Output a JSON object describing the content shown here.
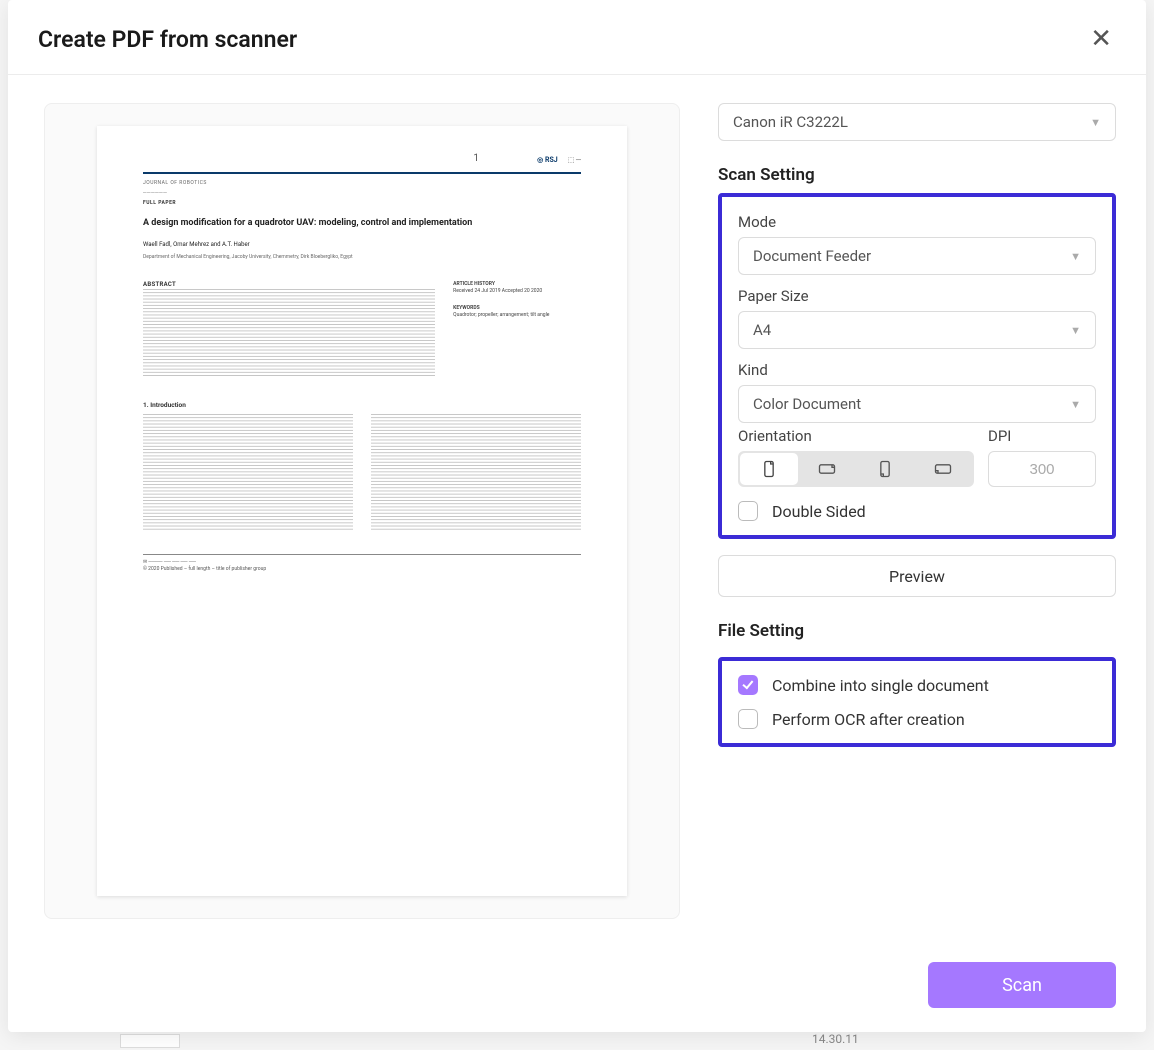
{
  "dialog": {
    "title": "Create PDF from scanner",
    "close_tooltip": "Close"
  },
  "scanner_select": {
    "value": "Canon iR C3222L"
  },
  "sections": {
    "scan_setting": "Scan Setting",
    "file_setting": "File Setting"
  },
  "scan": {
    "mode": {
      "label": "Mode",
      "value": "Document Feeder"
    },
    "paper_size": {
      "label": "Paper Size",
      "value": "A4"
    },
    "kind": {
      "label": "Kind",
      "value": "Color Document"
    },
    "orientation": {
      "label": "Orientation",
      "selected_index": 0
    },
    "dpi": {
      "label": "DPI",
      "value": "300"
    },
    "double_sided": {
      "label": "Double Sided",
      "checked": false
    },
    "preview_button": "Preview"
  },
  "file": {
    "combine": {
      "label": "Combine into single document",
      "checked": true
    },
    "ocr": {
      "label": "Perform OCR after creation",
      "checked": false
    }
  },
  "actions": {
    "scan": "Scan"
  },
  "preview_doc": {
    "page_num": "1",
    "logo1": "RSJ",
    "journal_line": "JOURNAL OF ROBOTICS",
    "category": "FULL PAPER",
    "title": "A design modification for a quadrotor UAV: modeling, control and implementation",
    "authors": "Waell Fadl, Omar Mehrez and A.T. Haber",
    "affiliation": "Department of Mechanical Engineering, Jacoby University, Chemmetry, Dirk Bloebergliko, Egypt",
    "abstract_head": "ABSTRACT",
    "intro_head": "1. Introduction",
    "history_head": "ARTICLE HISTORY",
    "history_text": "Received 24 Jul 2019\nAccepted 20 2020",
    "keywords_head": "KEYWORDS",
    "keywords_text": "Quadrotor; propeller; arrangement; tilt angle",
    "footer2": "© 2020 Published – full length – title of publisher group"
  },
  "background": {
    "time": "14.30.11"
  }
}
